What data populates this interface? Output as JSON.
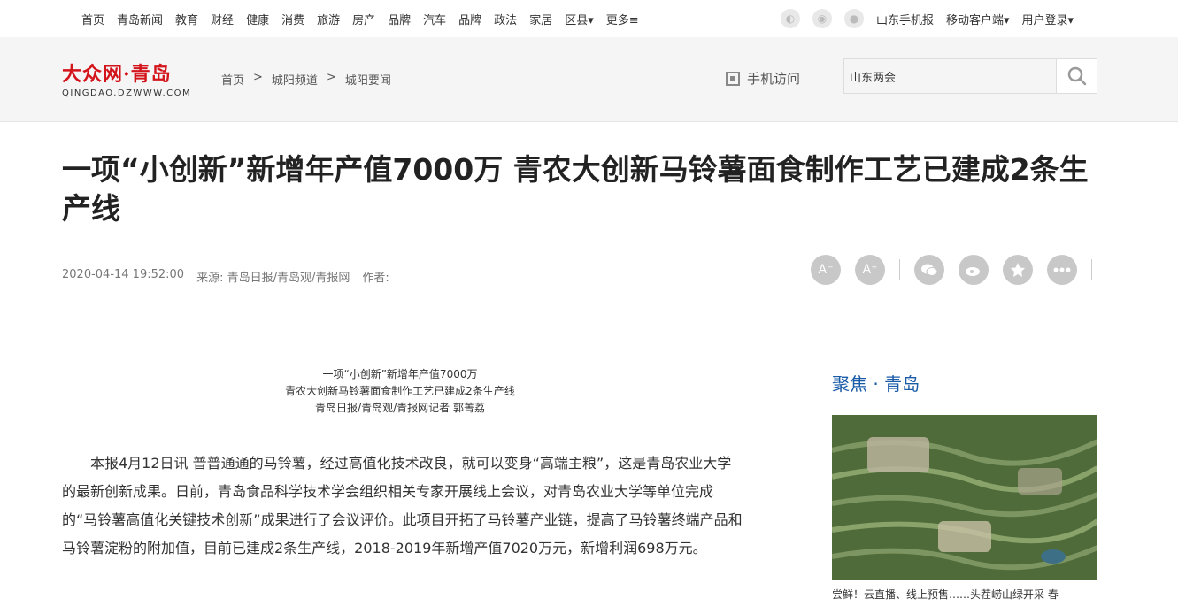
{
  "topnav": {
    "links": [
      "首页",
      "青岛新闻",
      "教育",
      "财经",
      "健康",
      "消费",
      "旅游",
      "房产",
      "品牌",
      "汽车",
      "品牌",
      "政法",
      "家居",
      "区县▾",
      "更多≡"
    ],
    "mobile_news": "山东手机报",
    "mobile_client": "移动客户端▾",
    "login": "用户登录▾"
  },
  "header": {
    "logo_cn": "大众网·青岛",
    "logo_en": "QINGDAO.DZWWW.COM",
    "breadcrumb": [
      "首页",
      ">",
      "城阳频道",
      ">",
      "城阳要闻"
    ],
    "mobile_visit": "手机访问",
    "search_value": "山东两会"
  },
  "article": {
    "title": "一项“小创新”新增年产值7000万 青农大创新马铃薯面食制作工艺已建成2条生产线",
    "date": "2020-04-14 19:52:00",
    "source": "来源: 青岛日报/青岛观/青报网",
    "author": "作者:",
    "caption_lines": [
      "一项“小创新”新增年产值7000万",
      "青农大创新马铃薯面食制作工艺已建成2条生产线",
      "青岛日报/青岛观/青报网记者 郭菁荔"
    ],
    "body": "本报4月12日讯 普普通通的马铃薯，经过高值化技术改良，就可以变身“高端主粮”，这是青岛农业大学的最新创新成果。日前，青岛食品科学技术学会组织相关专家开展线上会议，对青岛农业大学等单位完成的“马铃薯高值化关键技术创新”成果进行了会议评价。此项目开拓了马铃薯产业链，提高了马铃薯终端产品和马铃薯淀粉的附加值，目前已建成2条生产线，2018-2019年新增产值7020万元，新增利润698万元。"
  },
  "tools": {
    "font_small": "A⁻",
    "font_large": "A⁺"
  },
  "sidebar": {
    "title": "聚焦 · 青岛",
    "image_caption": "尝鲜！云直播、线上预售……头茬崂山绿开采 春"
  }
}
